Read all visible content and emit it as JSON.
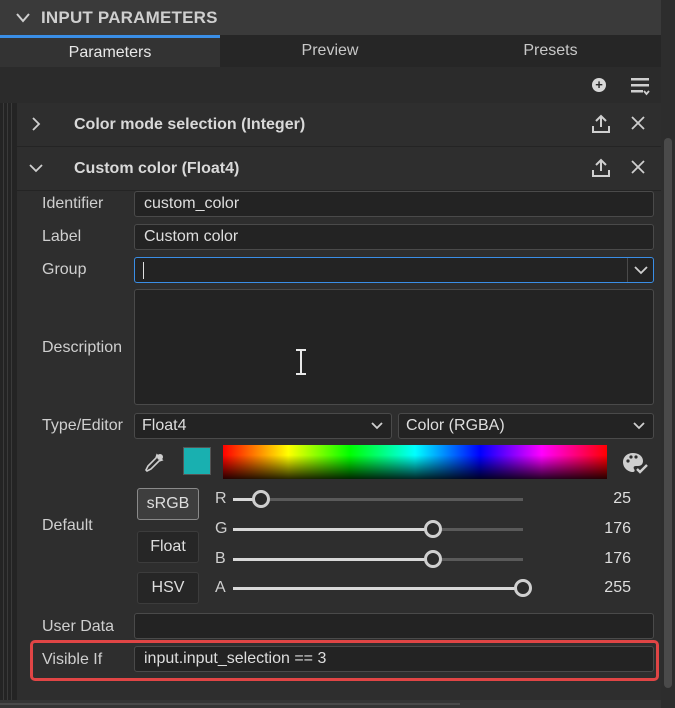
{
  "panel": {
    "title": "INPUT PARAMETERS"
  },
  "tabs": [
    {
      "label": "Parameters",
      "active": true
    },
    {
      "label": "Preview",
      "active": false
    },
    {
      "label": "Presets",
      "active": false
    }
  ],
  "toolbar": {
    "add_icon": "plus-circle-icon",
    "menu_icon": "list-menu-icon"
  },
  "sections": [
    {
      "title": "Color mode selection (Integer)",
      "expanded": false
    },
    {
      "title": "Custom color (Float4)",
      "expanded": true
    }
  ],
  "form": {
    "identifier_label": "Identifier",
    "identifier_value": "custom_color",
    "label_label": "Label",
    "label_value": "Custom color",
    "group_label": "Group",
    "group_value": "",
    "description_label": "Description",
    "description_value": "",
    "type_editor_label": "Type/Editor",
    "type_value": "Float4",
    "editor_value": "Color (RGBA)",
    "default_label": "Default",
    "swatch_color": "#19b0b0",
    "modes": [
      "sRGB",
      "Float",
      "HSV"
    ],
    "active_mode": "sRGB",
    "channels": [
      {
        "name": "R",
        "value": "25",
        "fraction": 0.098
      },
      {
        "name": "G",
        "value": "176",
        "fraction": 0.69
      },
      {
        "name": "B",
        "value": "176",
        "fraction": 0.69
      },
      {
        "name": "A",
        "value": "255",
        "fraction": 1.0
      }
    ],
    "user_data_label": "User Data",
    "user_data_value": "",
    "visible_if_label": "Visible If",
    "visible_if_value": "input.input_selection == 3"
  },
  "colors": {
    "accent": "#3a8ee6",
    "highlight": "#e04545"
  }
}
